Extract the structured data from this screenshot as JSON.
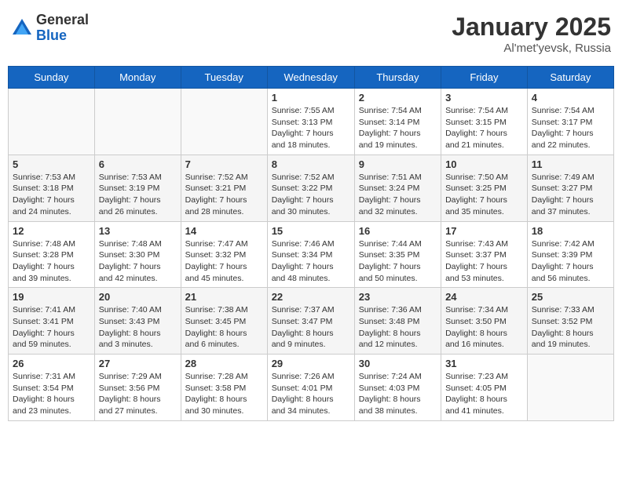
{
  "header": {
    "logo_general": "General",
    "logo_blue": "Blue",
    "title": "January 2025",
    "subtitle": "Al'met'yevsk, Russia"
  },
  "weekdays": [
    "Sunday",
    "Monday",
    "Tuesday",
    "Wednesday",
    "Thursday",
    "Friday",
    "Saturday"
  ],
  "rows": [
    [
      {
        "day": "",
        "info": ""
      },
      {
        "day": "",
        "info": ""
      },
      {
        "day": "",
        "info": ""
      },
      {
        "day": "1",
        "info": "Sunrise: 7:55 AM\nSunset: 3:13 PM\nDaylight: 7 hours\nand 18 minutes."
      },
      {
        "day": "2",
        "info": "Sunrise: 7:54 AM\nSunset: 3:14 PM\nDaylight: 7 hours\nand 19 minutes."
      },
      {
        "day": "3",
        "info": "Sunrise: 7:54 AM\nSunset: 3:15 PM\nDaylight: 7 hours\nand 21 minutes."
      },
      {
        "day": "4",
        "info": "Sunrise: 7:54 AM\nSunset: 3:17 PM\nDaylight: 7 hours\nand 22 minutes."
      }
    ],
    [
      {
        "day": "5",
        "info": "Sunrise: 7:53 AM\nSunset: 3:18 PM\nDaylight: 7 hours\nand 24 minutes."
      },
      {
        "day": "6",
        "info": "Sunrise: 7:53 AM\nSunset: 3:19 PM\nDaylight: 7 hours\nand 26 minutes."
      },
      {
        "day": "7",
        "info": "Sunrise: 7:52 AM\nSunset: 3:21 PM\nDaylight: 7 hours\nand 28 minutes."
      },
      {
        "day": "8",
        "info": "Sunrise: 7:52 AM\nSunset: 3:22 PM\nDaylight: 7 hours\nand 30 minutes."
      },
      {
        "day": "9",
        "info": "Sunrise: 7:51 AM\nSunset: 3:24 PM\nDaylight: 7 hours\nand 32 minutes."
      },
      {
        "day": "10",
        "info": "Sunrise: 7:50 AM\nSunset: 3:25 PM\nDaylight: 7 hours\nand 35 minutes."
      },
      {
        "day": "11",
        "info": "Sunrise: 7:49 AM\nSunset: 3:27 PM\nDaylight: 7 hours\nand 37 minutes."
      }
    ],
    [
      {
        "day": "12",
        "info": "Sunrise: 7:48 AM\nSunset: 3:28 PM\nDaylight: 7 hours\nand 39 minutes."
      },
      {
        "day": "13",
        "info": "Sunrise: 7:48 AM\nSunset: 3:30 PM\nDaylight: 7 hours\nand 42 minutes."
      },
      {
        "day": "14",
        "info": "Sunrise: 7:47 AM\nSunset: 3:32 PM\nDaylight: 7 hours\nand 45 minutes."
      },
      {
        "day": "15",
        "info": "Sunrise: 7:46 AM\nSunset: 3:34 PM\nDaylight: 7 hours\nand 48 minutes."
      },
      {
        "day": "16",
        "info": "Sunrise: 7:44 AM\nSunset: 3:35 PM\nDaylight: 7 hours\nand 50 minutes."
      },
      {
        "day": "17",
        "info": "Sunrise: 7:43 AM\nSunset: 3:37 PM\nDaylight: 7 hours\nand 53 minutes."
      },
      {
        "day": "18",
        "info": "Sunrise: 7:42 AM\nSunset: 3:39 PM\nDaylight: 7 hours\nand 56 minutes."
      }
    ],
    [
      {
        "day": "19",
        "info": "Sunrise: 7:41 AM\nSunset: 3:41 PM\nDaylight: 7 hours\nand 59 minutes."
      },
      {
        "day": "20",
        "info": "Sunrise: 7:40 AM\nSunset: 3:43 PM\nDaylight: 8 hours\nand 3 minutes."
      },
      {
        "day": "21",
        "info": "Sunrise: 7:38 AM\nSunset: 3:45 PM\nDaylight: 8 hours\nand 6 minutes."
      },
      {
        "day": "22",
        "info": "Sunrise: 7:37 AM\nSunset: 3:47 PM\nDaylight: 8 hours\nand 9 minutes."
      },
      {
        "day": "23",
        "info": "Sunrise: 7:36 AM\nSunset: 3:48 PM\nDaylight: 8 hours\nand 12 minutes."
      },
      {
        "day": "24",
        "info": "Sunrise: 7:34 AM\nSunset: 3:50 PM\nDaylight: 8 hours\nand 16 minutes."
      },
      {
        "day": "25",
        "info": "Sunrise: 7:33 AM\nSunset: 3:52 PM\nDaylight: 8 hours\nand 19 minutes."
      }
    ],
    [
      {
        "day": "26",
        "info": "Sunrise: 7:31 AM\nSunset: 3:54 PM\nDaylight: 8 hours\nand 23 minutes."
      },
      {
        "day": "27",
        "info": "Sunrise: 7:29 AM\nSunset: 3:56 PM\nDaylight: 8 hours\nand 27 minutes."
      },
      {
        "day": "28",
        "info": "Sunrise: 7:28 AM\nSunset: 3:58 PM\nDaylight: 8 hours\nand 30 minutes."
      },
      {
        "day": "29",
        "info": "Sunrise: 7:26 AM\nSunset: 4:01 PM\nDaylight: 8 hours\nand 34 minutes."
      },
      {
        "day": "30",
        "info": "Sunrise: 7:24 AM\nSunset: 4:03 PM\nDaylight: 8 hours\nand 38 minutes."
      },
      {
        "day": "31",
        "info": "Sunrise: 7:23 AM\nSunset: 4:05 PM\nDaylight: 8 hours\nand 41 minutes."
      },
      {
        "day": "",
        "info": ""
      }
    ]
  ]
}
